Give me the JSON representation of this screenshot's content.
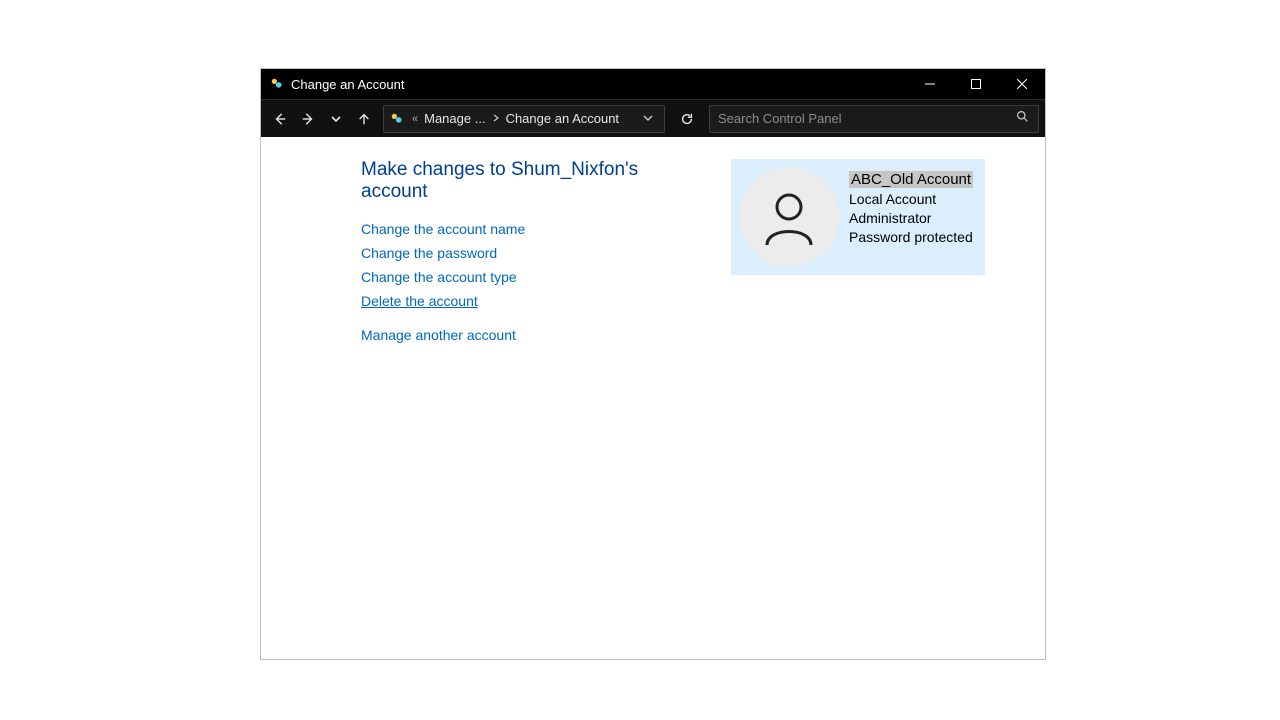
{
  "window": {
    "title": "Change an Account"
  },
  "breadcrumb": {
    "prefix": "«",
    "items": [
      "Manage ...",
      "Change an Account"
    ]
  },
  "search": {
    "placeholder": "Search Control Panel"
  },
  "page": {
    "heading": "Make changes to Shum_Nixfon's account",
    "links": {
      "change_name": "Change the account name",
      "change_password": "Change the password",
      "change_type": "Change the account type",
      "delete": "Delete the account",
      "manage_another": "Manage another account"
    }
  },
  "account": {
    "name": "ABC_Old Account",
    "type": "Local Account",
    "role": "Administrator",
    "protection": "Password protected"
  }
}
